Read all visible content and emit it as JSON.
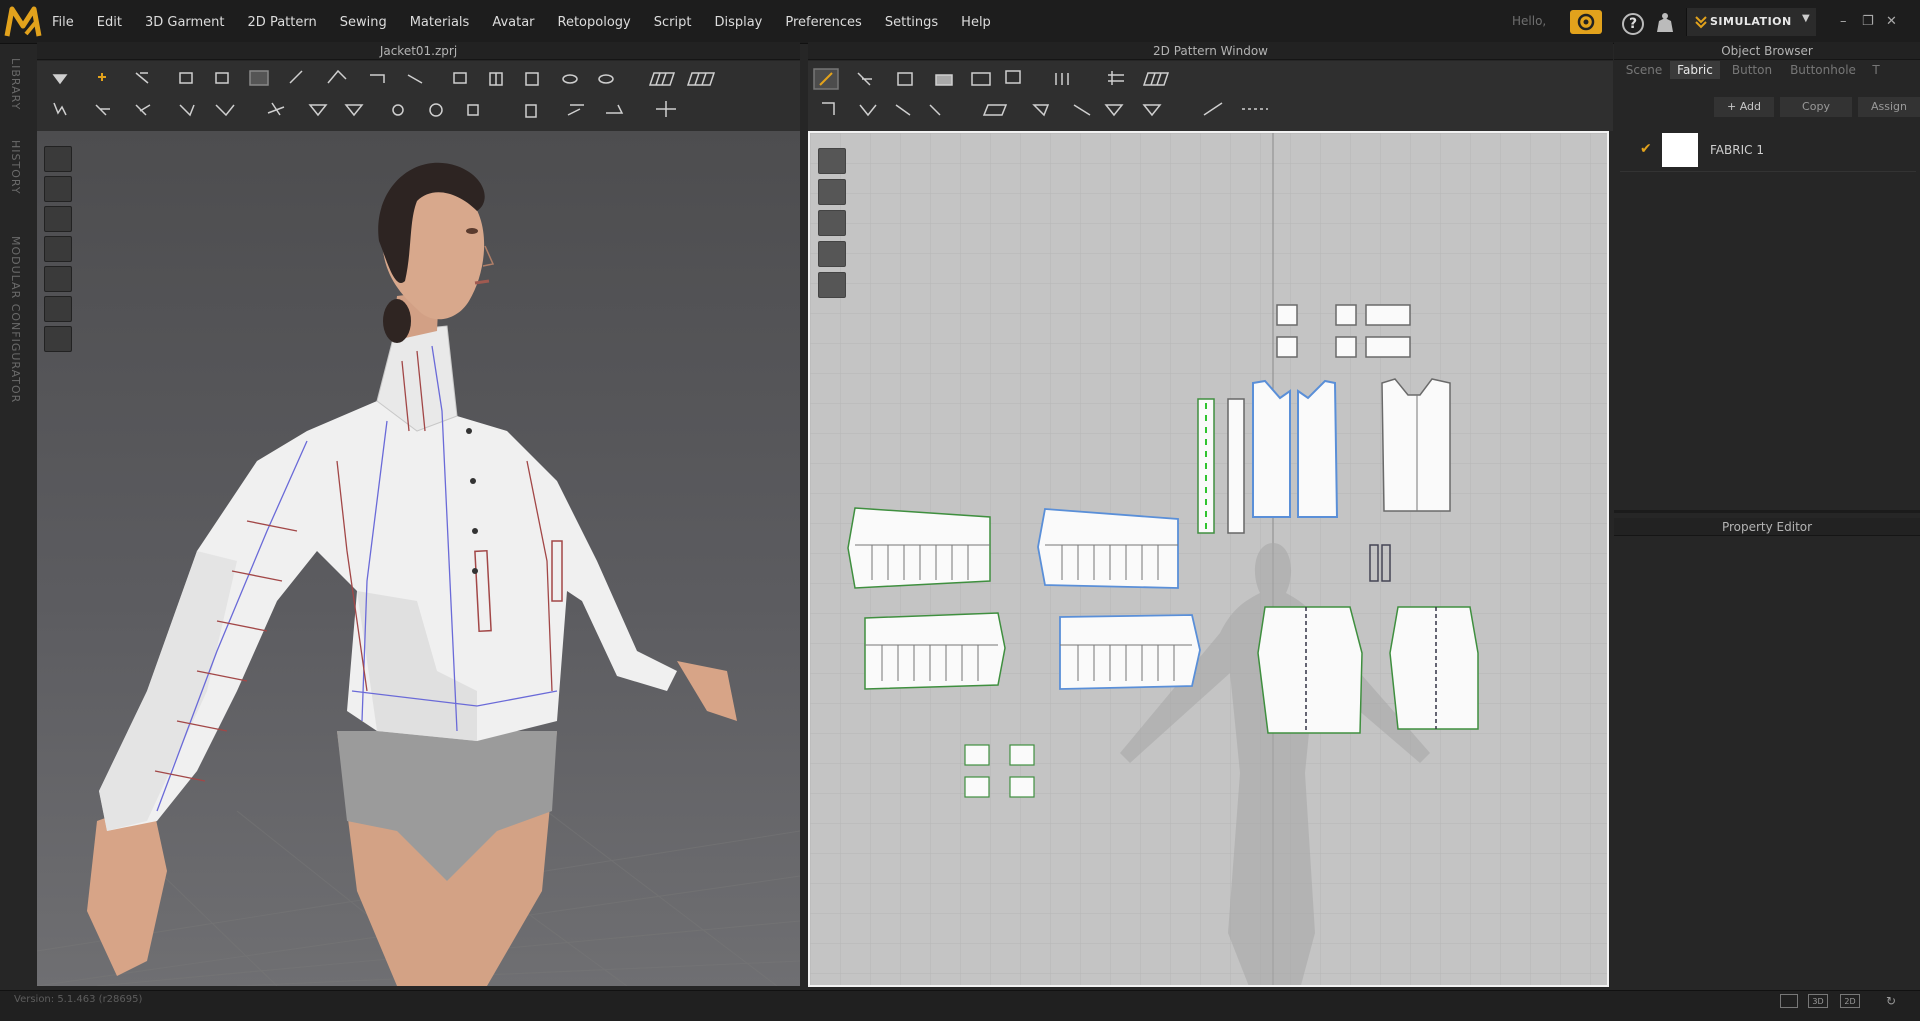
{
  "app": {
    "logo_icon": "marvelous-designer-logo",
    "accent": "#e2a21c"
  },
  "menu": {
    "items": [
      "File",
      "Edit",
      "3D Garment",
      "2D Pattern",
      "Sewing",
      "Materials",
      "Avatar",
      "Retopology",
      "Script",
      "Display",
      "Preferences",
      "Settings",
      "Help"
    ]
  },
  "topright": {
    "hello": "Hello,",
    "mode": "SIMULATION"
  },
  "side_labels": [
    "LIBRARY",
    "HISTORY",
    "MODULAR CONFIGURATOR"
  ],
  "pane3d": {
    "title": "Jacket01.zprj"
  },
  "pane2d": {
    "title": "2D Pattern Window"
  },
  "object_browser": {
    "title": "Object Browser",
    "tabs": [
      "Scene",
      "Fabric",
      "Button",
      "Buttonhole",
      "T"
    ],
    "active_tab": "Fabric",
    "buttons": {
      "add": "+ Add",
      "copy": "Copy",
      "assign": "Assign"
    },
    "fabrics": [
      {
        "name": "FABRIC 1",
        "checked": true,
        "swatch_color": "#ffffff"
      }
    ]
  },
  "property_editor": {
    "title": "Property Editor"
  },
  "status": {
    "version": "Version: 5.1.463 (r28695)",
    "views": [
      "3D",
      "2D"
    ]
  }
}
